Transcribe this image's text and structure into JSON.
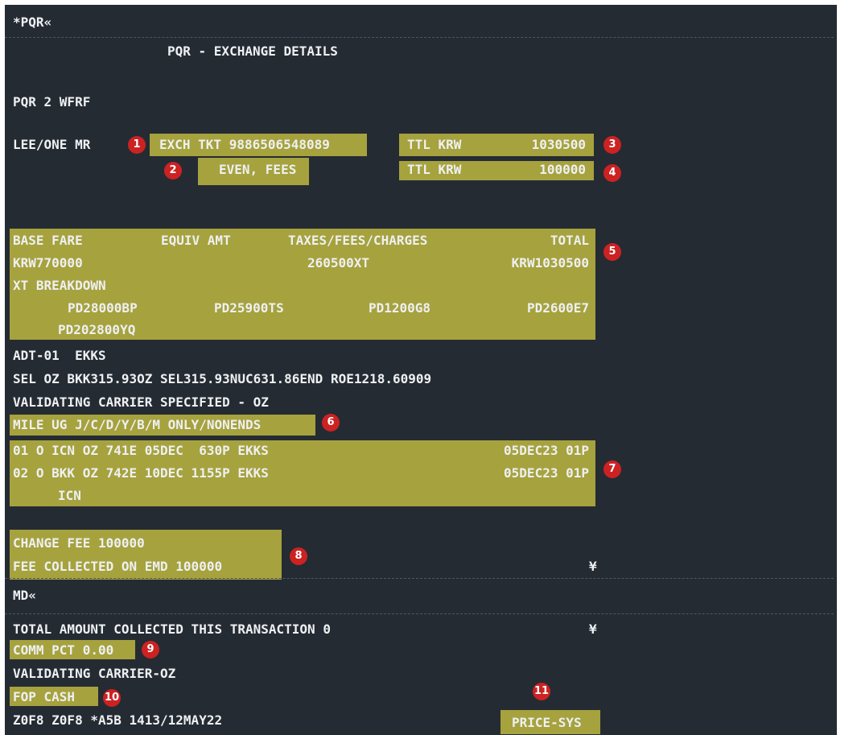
{
  "command": "*PQR«",
  "title": "PQR - EXCHANGE DETAILS",
  "pqr_ref": "PQR 2 WFRF",
  "passenger": "LEE/ONE MR",
  "exchange": {
    "ticket": "EXCH TKT 9886506548089",
    "even_fees": "EVEN, FEES",
    "ttl1_label": "TTL KRW",
    "ttl1_value": "1030500",
    "ttl2_label": "TTL KRW",
    "ttl2_value": "100000"
  },
  "fare": {
    "h_base": "BASE FARE",
    "h_equiv": "EQUIV AMT",
    "h_taxes": "TAXES/FEES/CHARGES",
    "h_total": "TOTAL",
    "base": "KRW770000",
    "taxes": "260500XT",
    "total": "KRW1030500",
    "xt_label": "XT BREAKDOWN",
    "xt_items": [
      "PD28000BP",
      "PD25900TS",
      "PD1200G8",
      "PD2600E7",
      "PD202800YQ"
    ]
  },
  "adt": "ADT-01  EKKS",
  "fare_calc": "SEL OZ BKK315.93OZ SEL315.93NUC631.86END ROE1218.60909",
  "validating_specified": "VALIDATING CARRIER SPECIFIED - OZ",
  "endorsement": "MILE UG J/C/D/Y/B/M ONLY/NONENDS",
  "segments": [
    {
      "line": "01 O ICN OZ 741E 05DEC  630P EKKS",
      "status": "05DEC23 01P"
    },
    {
      "line": "02 O BKK OZ 742E 10DEC 1155P EKKS",
      "status": "05DEC23 01P"
    }
  ],
  "segment_dest": "ICN",
  "change_fee": "CHANGE FEE 100000",
  "fee_collected": "FEE COLLECTED ON EMD 100000",
  "yen_symbol": "¥",
  "md_prompt": "MD«",
  "total_collected": "TOTAL AMOUNT COLLECTED THIS TRANSACTION 0",
  "comm": "COMM PCT 0.00",
  "validating_carrier": "VALIDATING CARRIER-OZ",
  "fop": "FOP CASH",
  "agent_line": "Z0F8 Z0F8 *A5B 1413/12MAY22",
  "price_sys": "PRICE-SYS",
  "badges": [
    "1",
    "2",
    "3",
    "4",
    "5",
    "6",
    "7",
    "8",
    "9",
    "10",
    "11"
  ],
  "colors": {
    "background": "#252b33",
    "highlight": "#a6a23e",
    "badge": "#cc2222",
    "text": "#eef0f2"
  }
}
